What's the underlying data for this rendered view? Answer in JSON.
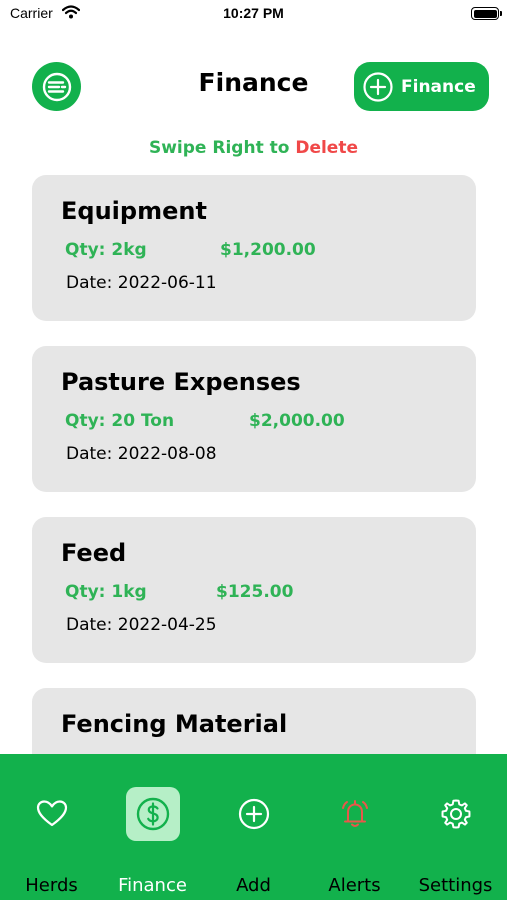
{
  "status_bar": {
    "carrier": "Carrier",
    "time": "10:27 PM",
    "wifi_icon": "wifi-icon",
    "battery_icon": "battery-icon"
  },
  "header": {
    "menu_icon": "menu-icon",
    "title": "Finance",
    "add_button": {
      "icon": "plus-circle-icon",
      "label": "Finance"
    }
  },
  "swipe_hint": {
    "prefix": "Swipe Right to",
    "action": "Delete"
  },
  "finance_items": [
    {
      "title": "Equipment",
      "qty": "Qty: 2kg",
      "amount": "$1,200.00",
      "date": "Date: 2022-06-11"
    },
    {
      "title": "Pasture Expenses",
      "qty": "Qty: 20 Ton",
      "amount": "$2,000.00",
      "date": "Date: 2022-08-08"
    },
    {
      "title": "Feed",
      "qty": "Qty: 1kg",
      "amount": "$125.00",
      "date": "Date: 2022-04-25"
    },
    {
      "title": "Fencing Material",
      "qty": "",
      "amount": "",
      "date": ""
    }
  ],
  "tab_bar": {
    "active": "Finance",
    "tabs": [
      {
        "label": "Herds",
        "icon": "heart-icon"
      },
      {
        "label": "Finance",
        "icon": "dollar-circle-icon"
      },
      {
        "label": "Add",
        "icon": "plus-circle-icon"
      },
      {
        "label": "Alerts",
        "icon": "alarm-bell-icon"
      },
      {
        "label": "Settings",
        "icon": "gear-icon"
      }
    ]
  },
  "colors": {
    "brand_green": "#12b14c",
    "text_green": "#2fb356",
    "delete_red": "#f04848",
    "card_bg": "#e6e6e6",
    "active_tab_bg": "#b6efc7",
    "alert_icon_red": "#e8574a"
  }
}
